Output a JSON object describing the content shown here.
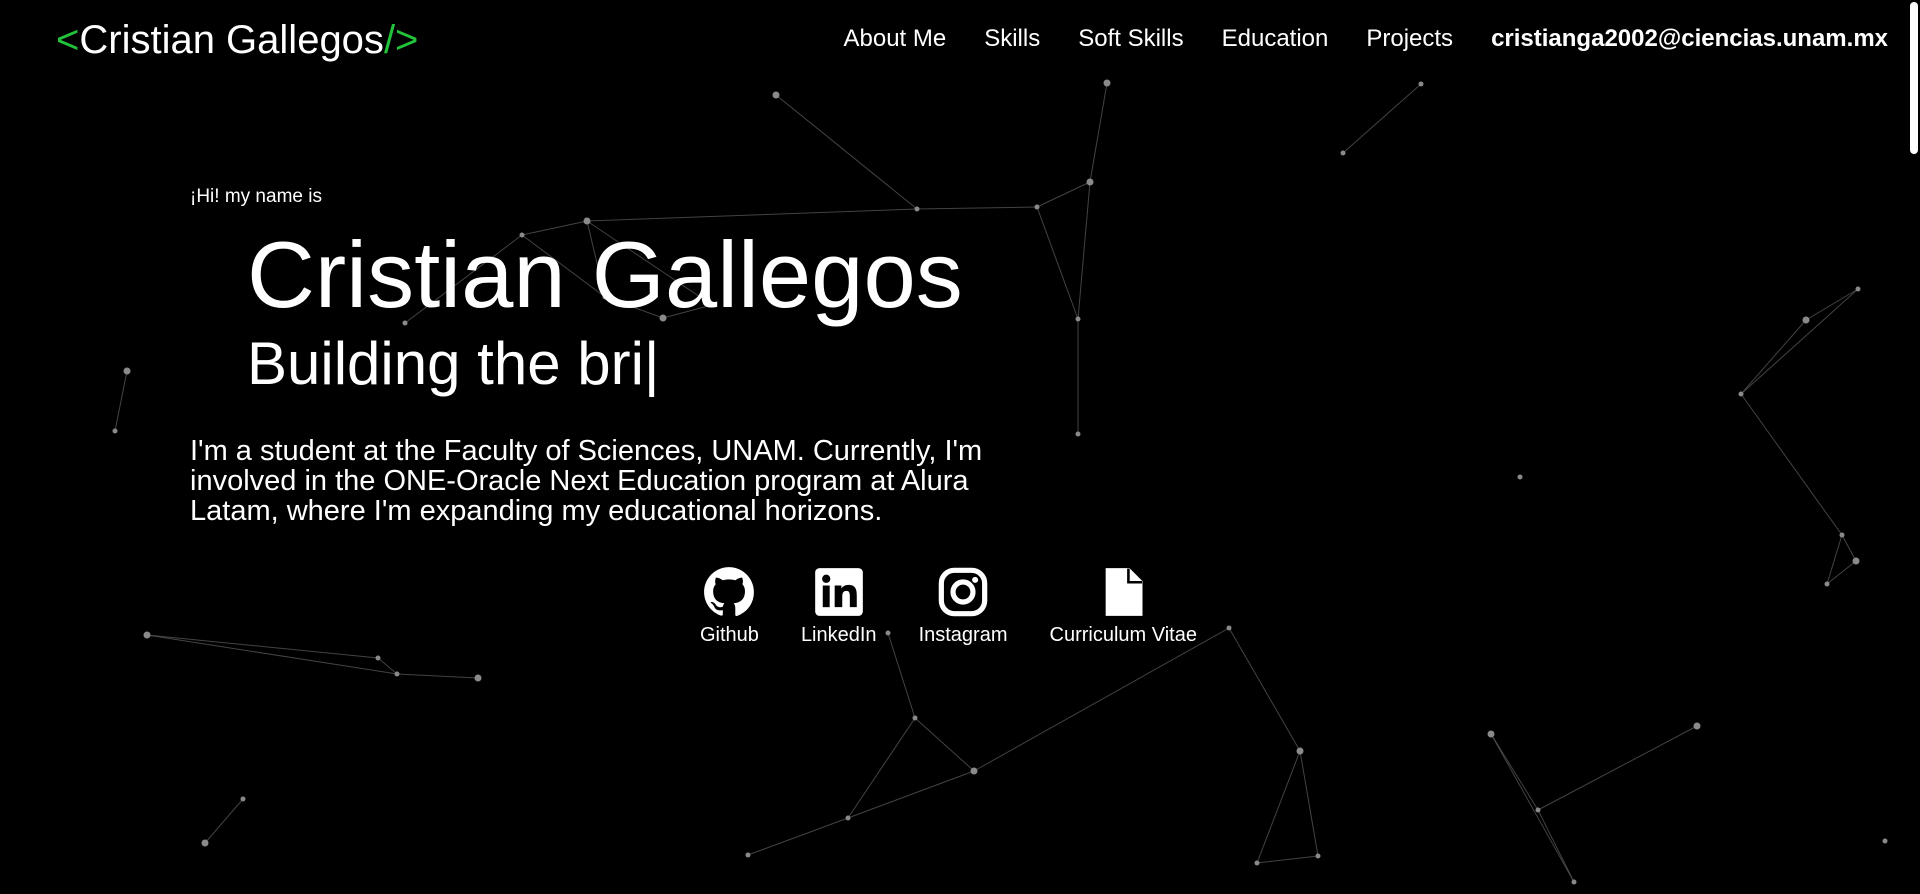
{
  "header": {
    "logo_open": "<",
    "logo_name": "Cristian Gallegos",
    "logo_close": "/>",
    "nav": [
      "About Me",
      "Skills",
      "Soft Skills",
      "Education",
      "Projects"
    ],
    "email": "cristianga2002@ciencias.unam.mx"
  },
  "hero": {
    "greeting": "¡Hi! my name is",
    "name": "Cristian Gallegos",
    "tagline": "Building the bri|",
    "bio": "I'm a student at the Faculty of Sciences, UNAM. Currently, I'm involved in the ONE-Oracle Next Education program at Alura Latam, where I'm expanding my educational horizons."
  },
  "socials": [
    {
      "label": "Github",
      "icon": "github-icon"
    },
    {
      "label": "LinkedIn",
      "icon": "linkedin-icon"
    },
    {
      "label": "Instagram",
      "icon": "instagram-icon"
    },
    {
      "label": "Curriculum Vitae",
      "icon": "document-icon"
    }
  ],
  "colors": {
    "background": "#000000",
    "accent": "#22c33a",
    "text": "#ffffff"
  }
}
